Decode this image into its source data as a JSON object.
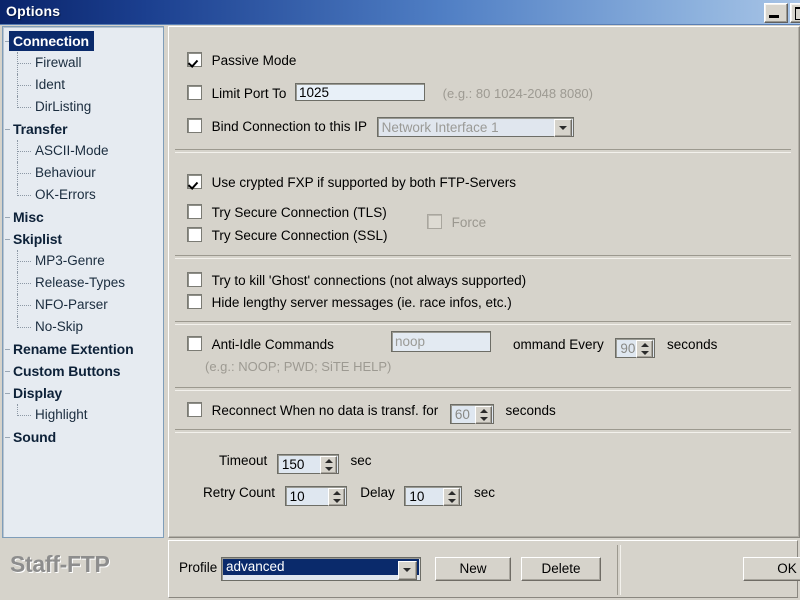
{
  "window": {
    "title": "Options",
    "minimize_icon": "minimize-icon",
    "maximize_icon": "maximize-icon"
  },
  "brand": {
    "name": "Staff-FTP"
  },
  "sidebar": {
    "items": [
      {
        "label": "Connection",
        "level": "root",
        "selected": true
      },
      {
        "label": "Firewall",
        "level": "child",
        "selected": false
      },
      {
        "label": "Ident",
        "level": "child",
        "selected": false
      },
      {
        "label": "DirListing",
        "level": "child",
        "selected": false,
        "last": true
      },
      {
        "label": "Transfer",
        "level": "root",
        "selected": false
      },
      {
        "label": "ASCII-Mode",
        "level": "child",
        "selected": false
      },
      {
        "label": "Behaviour",
        "level": "child",
        "selected": false
      },
      {
        "label": "OK-Errors",
        "level": "child",
        "selected": false,
        "last": true
      },
      {
        "label": "Misc",
        "level": "root",
        "selected": false
      },
      {
        "label": "Skiplist",
        "level": "root",
        "selected": false
      },
      {
        "label": "MP3-Genre",
        "level": "child",
        "selected": false
      },
      {
        "label": "Release-Types",
        "level": "child",
        "selected": false
      },
      {
        "label": "NFO-Parser",
        "level": "child",
        "selected": false
      },
      {
        "label": "No-Skip",
        "level": "child",
        "selected": false,
        "last": true
      },
      {
        "label": "Rename Extention",
        "level": "root",
        "selected": false
      },
      {
        "label": "Custom Buttons",
        "level": "root",
        "selected": false
      },
      {
        "label": "Display",
        "level": "root",
        "selected": false
      },
      {
        "label": "Highlight",
        "level": "child",
        "selected": false,
        "last": true
      },
      {
        "label": "Sound",
        "level": "root",
        "selected": false
      }
    ]
  },
  "connection": {
    "passive_mode": {
      "label": "Passive Mode",
      "checked": true
    },
    "limit_port": {
      "label": "Limit Port To",
      "checked": false,
      "value": "1025",
      "hint": "(e.g.: 80 1024-2048 8080)"
    },
    "bind_connection": {
      "label": "Bind Connection to this IP",
      "checked": false,
      "value": "Network Interface 1"
    },
    "crypted_fxp": {
      "label": "Use crypted FXP if supported by both FTP-Servers",
      "checked": true
    },
    "tls": {
      "label": "Try Secure Connection (TLS)",
      "checked": false
    },
    "ssl": {
      "label": "Try Secure Connection (SSL)",
      "checked": false
    },
    "force": {
      "label": "Force",
      "checked": false,
      "disabled": true
    },
    "kill_ghost": {
      "label": "Try to kill 'Ghost' connections (not always supported)",
      "checked": false
    },
    "hide_lengthy": {
      "label": "Hide lengthy server messages (ie. race infos, etc.)",
      "checked": false
    },
    "anti_idle": {
      "label": "Anti-Idle Commands",
      "checked": false,
      "command_value": "noop",
      "mid_label": "ommand Every",
      "interval": "90",
      "unit": "seconds",
      "hint": "(e.g.: NOOP; PWD; SiTE HELP)"
    },
    "reconnect": {
      "label": "Reconnect When no data is transf. for",
      "checked": false,
      "value": "60",
      "unit": "seconds"
    },
    "timeout": {
      "label": "Timeout",
      "value": "150",
      "unit": "sec"
    },
    "retry_count": {
      "label": "Retry Count",
      "value": "10"
    },
    "delay": {
      "label": "Delay",
      "value": "10",
      "unit": "sec"
    }
  },
  "footer": {
    "profile_label": "Profile",
    "profile_value": "advanced",
    "new_label": "New",
    "delete_label": "Delete",
    "ok_label": "OK"
  },
  "colors": {
    "titlebar_dark": "#0a246a",
    "titlebar_light": "#a8c4e6",
    "face": "#d6d3cb",
    "tree_bg": "#e6ebf1",
    "selection": "#0a2a6b"
  }
}
